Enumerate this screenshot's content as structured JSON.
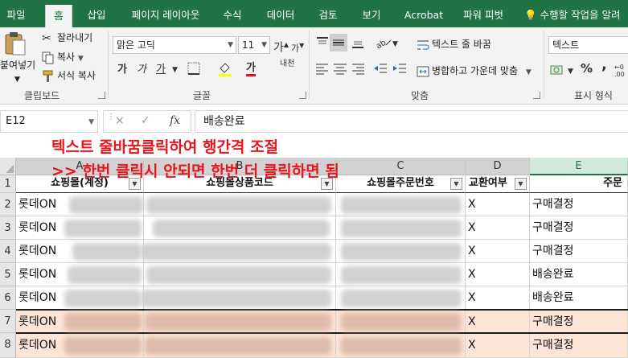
{
  "ribbon_tabs": [
    "파일",
    "홈",
    "삽입",
    "페이지 레이아웃",
    "수식",
    "데이터",
    "검토",
    "보기",
    "Acrobat",
    "파워 피벗"
  ],
  "active_tab": "홈",
  "tell_me": "수행할 작업을 알려",
  "clipboard": {
    "paste": "붙여넣기",
    "cut": "잘라내기",
    "copy": "복사",
    "format_painter": "서식 복사",
    "label": "클립보드"
  },
  "font": {
    "name": "맑은 고딕",
    "size": "11",
    "grow": "가",
    "shrink": "가",
    "bold": "가",
    "italic": "가",
    "underline": "가",
    "font_color_glyph": "가",
    "phonetic": "내천",
    "label": "글꼴"
  },
  "alignment": {
    "wrap_text": "텍스트 줄 바꿈",
    "merge_center": "병합하고 가운데 맞춤",
    "label": "맞춤"
  },
  "number": {
    "format": "텍스트",
    "label": "표시 형식",
    "percent": "%",
    "comma": ","
  },
  "colors": {
    "excel_green": "#217346",
    "annotation_red": "#e8161c",
    "highlight_row": "#fce4d6"
  },
  "formula_bar": {
    "name_box": "E12",
    "cancel": "×",
    "enter": "✓",
    "fx": "fx",
    "content": "배송완료"
  },
  "annotation": {
    "line1": "텍스트 줄바꿈클릭하여 행간격 조절",
    "line2": ">> 한번 클릭시 안되면 한번 더 클릭하면 됨"
  },
  "columns": [
    "A",
    "B",
    "C",
    "D",
    "E"
  ],
  "header_row": {
    "a": "쇼핑몰(계정)",
    "b": "쇼핑몰상품코드",
    "c": "쇼핑몰주문번호",
    "d": "교환여부",
    "e": "주문"
  },
  "rows": [
    {
      "num": "1"
    },
    {
      "num": "2",
      "a": "롯데ON",
      "d": "X",
      "e": "구매결정"
    },
    {
      "num": "3",
      "a": "롯데ON",
      "d": "X",
      "e": "구매결정"
    },
    {
      "num": "4",
      "a": "롯데ON",
      "d": "X",
      "e": "구매결정"
    },
    {
      "num": "5",
      "a": "롯데ON",
      "d": "X",
      "e": "배송완료"
    },
    {
      "num": "6",
      "a": "롯데ON",
      "d": "X",
      "e": "배송완료"
    },
    {
      "num": "7",
      "a": "롯데ON",
      "d": "X",
      "e": "구매결정"
    },
    {
      "num": "8",
      "a": "롯데ON",
      "d": "X",
      "e": "구매결정"
    }
  ]
}
